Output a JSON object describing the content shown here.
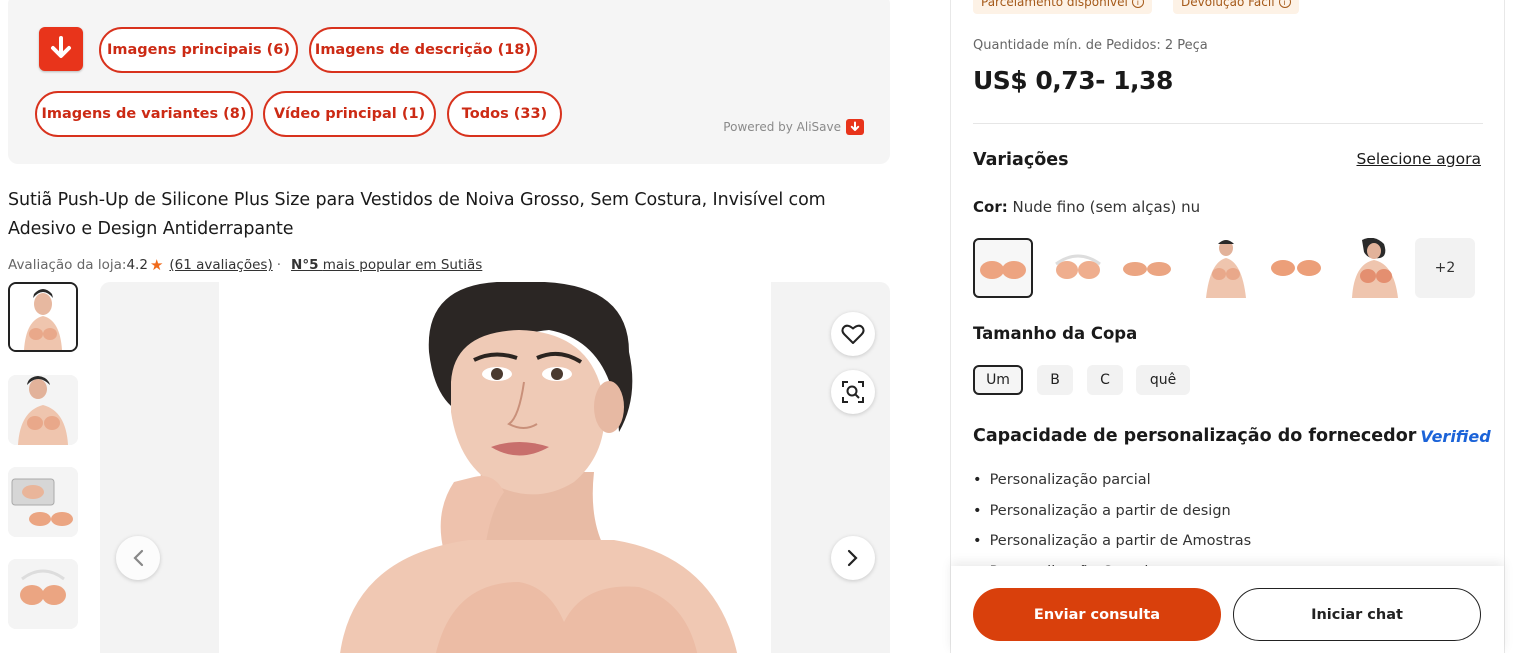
{
  "alisave": {
    "buttons": [
      "Imagens principais (6)",
      "Imagens de descrição (18)",
      "Imagens de variantes (8)",
      "Vídeo principal (1)",
      "Todos (33)"
    ],
    "powered_by": "Powered by AliSave",
    "download_icon": "download-arrow-icon",
    "accent_color": "#e8341b"
  },
  "product": {
    "title": "Sutiã Push-Up de Silicone Plus Size para Vestidos de Noiva Grosso, Sem Costura, Invisível com Adesivo e Design Antiderrapante",
    "store_rating_label": "Avaliação da loja:",
    "store_rating_value": "4.2",
    "reviews_link": "(61 avaliações)",
    "separator": "·",
    "rank_number": "N°5",
    "rank_text": "mais popular em Sutiãs"
  },
  "gallery": {
    "thumbnails": [
      "thumb-model-1",
      "thumb-model-2",
      "thumb-package",
      "thumb-bra"
    ],
    "favorite_icon": "heart-icon",
    "image_search_icon": "image-search-icon",
    "prev_icon": "chevron-left-icon",
    "next_icon": "chevron-right-icon"
  },
  "purchase": {
    "chips": [
      "Parcelamento disponível",
      "Devolução Fácil"
    ],
    "min_order": "Quantidade mín. de Pedidos: 2 Peça",
    "price": "US$ 0,73- 1,38",
    "variations_heading": "Variações",
    "select_now": "Selecione agora",
    "color_label": "Cor:",
    "color_value": "Nude fino (sem alças) nu",
    "more_colors": "+2",
    "cup_heading": "Tamanho da Copa",
    "cup_sizes": [
      "Um",
      "B",
      "C",
      "quê"
    ],
    "customization_heading": "Capacidade de personalização do fornecedor",
    "verified_badge": "Verified",
    "customization_items": [
      "Personalização parcial",
      "Personalização a partir de design",
      "Personalização a partir de Amostras",
      "Personalização Completa"
    ],
    "send_inquiry": "Enviar consulta",
    "start_chat": "Iniciar chat",
    "primary_color": "#d9400c"
  }
}
